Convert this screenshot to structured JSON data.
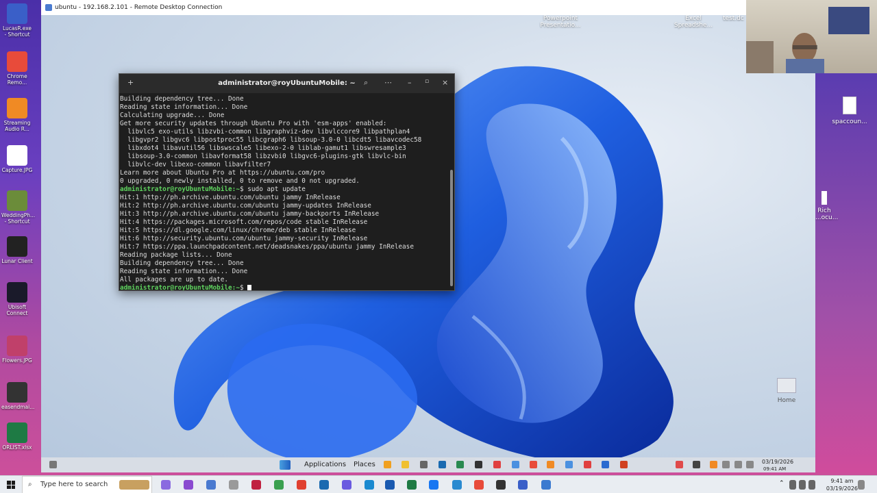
{
  "host_desktop_icons": [
    {
      "label": "LucasR.exe - Shortcut",
      "color": "#3a5fc8"
    },
    {
      "label": "Chrome Remo...",
      "color": "#e84b3a"
    },
    {
      "label": "Streaming Audio R...",
      "color": "#f08a24"
    },
    {
      "label": "Capture.JPG",
      "color": "#ffffff"
    },
    {
      "label": "WeddingPh... - Shortcut",
      "color": "#6b8c3a"
    },
    {
      "label": "Lunar Client",
      "color": "#222222"
    },
    {
      "label": "Ubisoft Connect",
      "color": "#1a1a2a"
    },
    {
      "label": "Flowers.JPG",
      "color": "#c0406a"
    },
    {
      "label": "easendmai...",
      "color": "#333333"
    },
    {
      "label": "ORLIST.xlsx",
      "color": "#1e7a44"
    }
  ],
  "rdp": {
    "title": "ubuntu - 192.168.2.101 - Remote Desktop Connection"
  },
  "guest_desktop_icons": {
    "ppt": "Powerpoint Presentatio...",
    "excel": "Excel Spreadshe...",
    "test": "test.dc",
    "home": "Home"
  },
  "right_strip_icons": {
    "sp": "spaccoun...",
    "rich": "Rich ...ocu..."
  },
  "terminal": {
    "title": "administrator@royUbuntuMobile: ~",
    "lines": [
      {
        "t": "Building dependency tree... Done"
      },
      {
        "t": "Reading state information... Done"
      },
      {
        "t": "Calculating upgrade... Done"
      },
      {
        "t": "Get more security updates through Ubuntu Pro with 'esm-apps' enabled:"
      },
      {
        "t": "  libvlc5 exo-utils libzvbi-common libgraphviz-dev libvlccore9 libpathplan4"
      },
      {
        "t": "  libgvpr2 libgvc6 libpostproc55 libcgraph6 libsoup-3.0-0 libcdt5 libavcodec58"
      },
      {
        "t": "  libxdot4 libavutil56 libswscale5 libexo-2-0 liblab-gamut1 libswresample3"
      },
      {
        "t": "  libsoup-3.0-common libavformat58 libzvbi0 libgvc6-plugins-gtk libvlc-bin"
      },
      {
        "t": "  libvlc-dev libexo-common libavfilter7"
      },
      {
        "t": "Learn more about Ubuntu Pro at https://ubuntu.com/pro"
      },
      {
        "t": "0 upgraded, 0 newly installed, 0 to remove and 0 not upgraded."
      },
      {
        "p": "administrator@royUbuntuMobile:~",
        "t": "$ sudo apt update"
      },
      {
        "t": "Hit:1 http://ph.archive.ubuntu.com/ubuntu jammy InRelease"
      },
      {
        "t": "Hit:2 http://ph.archive.ubuntu.com/ubuntu jammy-updates InRelease"
      },
      {
        "t": "Hit:3 http://ph.archive.ubuntu.com/ubuntu jammy-backports InRelease"
      },
      {
        "t": "Hit:4 https://packages.microsoft.com/repos/code stable InRelease"
      },
      {
        "t": "Hit:5 https://dl.google.com/linux/chrome/deb stable InRelease"
      },
      {
        "t": "Hit:6 http://security.ubuntu.com/ubuntu jammy-security InRelease"
      },
      {
        "t": "Hit:7 https://ppa.launchpadcontent.net/deadsnakes/ppa/ubuntu jammy InRelease"
      },
      {
        "t": "Reading package lists... Done"
      },
      {
        "t": "Building dependency tree... Done"
      },
      {
        "t": "Reading state information... Done"
      },
      {
        "t": "All packages are up to date."
      },
      {
        "p": "administrator@royUbuntuMobile:~",
        "t": "$ ",
        "cursor": true
      }
    ]
  },
  "ubuntu_panel": {
    "applications": "Applications",
    "places": "Places",
    "date": "03/19/2026",
    "time": "09:41 AM"
  },
  "taskbar": {
    "search_placeholder": "Type here to search",
    "time": "9:41 am",
    "date": "03/19/2026"
  }
}
